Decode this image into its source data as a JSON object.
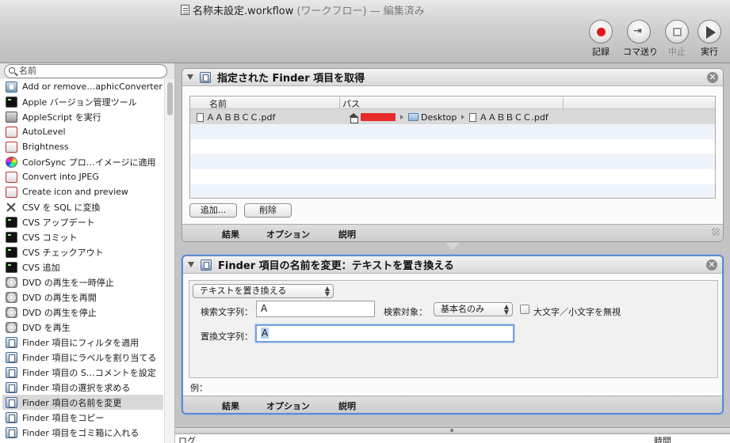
{
  "window": {
    "title": "名称未設定.workflow",
    "subtitle": "(ワークフロー) — 編集済み"
  },
  "toolbar": {
    "record_label": "記録",
    "step_label": "コマ送り",
    "stop_label": "中止",
    "run_label": "実行"
  },
  "search": {
    "value": "名前"
  },
  "library": {
    "items": [
      {
        "label": "Add or remove…aphicConverter",
        "icon": "robot-icon"
      },
      {
        "label": "Apple バージョン管理ツール",
        "icon": "terminal-icon"
      },
      {
        "label": "AppleScript を実行",
        "icon": "script-icon"
      },
      {
        "label": "AutoLevel",
        "icon": "preview-icon"
      },
      {
        "label": "Brightness",
        "icon": "preview-icon"
      },
      {
        "label": "ColorSync プロ…イメージに適用",
        "icon": "colorsync-icon"
      },
      {
        "label": "Convert into JPEG",
        "icon": "preview-icon"
      },
      {
        "label": "Create icon and preview",
        "icon": "preview-icon"
      },
      {
        "label": "CSV を SQL に変換",
        "icon": "tools-icon"
      },
      {
        "label": "CVS アップデート",
        "icon": "terminal-icon"
      },
      {
        "label": "CVS コミット",
        "icon": "terminal-icon"
      },
      {
        "label": "CVS チェックアウト",
        "icon": "terminal-icon"
      },
      {
        "label": "CVS 追加",
        "icon": "terminal-icon"
      },
      {
        "label": "DVD の再生を一時停止",
        "icon": "dvd-icon"
      },
      {
        "label": "DVD の再生を再開",
        "icon": "dvd-icon"
      },
      {
        "label": "DVD の再生を停止",
        "icon": "dvd-icon"
      },
      {
        "label": "DVD を再生",
        "icon": "dvd-icon"
      },
      {
        "label": "Finder 項目にフィルタを適用",
        "icon": "finder-icon"
      },
      {
        "label": "Finder 項目にラベルを割り当てる",
        "icon": "finder-icon"
      },
      {
        "label": "Finder 項目の S…コメントを設定",
        "icon": "finder-icon"
      },
      {
        "label": "Finder 項目の選択を求める",
        "icon": "finder-icon"
      },
      {
        "label": "Finder 項目の名前を変更",
        "icon": "finder-icon",
        "selected": true
      },
      {
        "label": "Finder 項目をコピー",
        "icon": "finder-icon"
      },
      {
        "label": "Finder 項目をゴミ箱に入れる",
        "icon": "finder-icon"
      }
    ]
  },
  "action1": {
    "title": "指定された Finder 項目を取得",
    "col_name": "名前",
    "col_path": "パス",
    "file_name": "ＡＡＢＢＣＣ.pdf",
    "path_folder": "Desktop",
    "path_file": "ＡＡＢＢＣＣ.pdf",
    "add_button": "追加...",
    "delete_button": "削除",
    "footer": {
      "results": "結果",
      "options": "オプション",
      "description": "説明"
    }
  },
  "action2": {
    "title": "Finder 項目の名前を変更：テキストを置き換える",
    "mode_value": "テキストを置き換える",
    "find_label": "検索文字列：",
    "find_value": "A",
    "target_label": "検索対象：",
    "target_value": "基本名のみ",
    "ignore_case_label": "大文字／小文字を無視",
    "ignore_case_checked": false,
    "replace_label": "置換文字列：",
    "replace_value": "A",
    "example_label": "例：",
    "footer": {
      "results": "結果",
      "options": "オプション",
      "description": "説明"
    }
  },
  "log": {
    "col_log": "ログ",
    "col_time": "時間"
  }
}
